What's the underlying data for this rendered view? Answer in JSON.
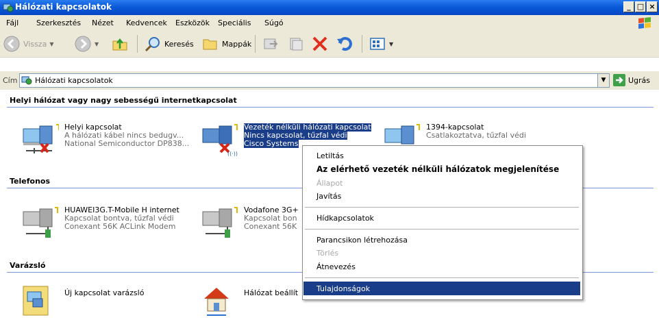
{
  "window": {
    "title": "Hálózati kapcsolatok",
    "min": "_",
    "max": "□",
    "close": "×"
  },
  "menu": [
    "Fájl",
    "Szerkesztés",
    "Nézet",
    "Kedvencek",
    "Eszközök",
    "Speciális",
    "Súgó"
  ],
  "toolbar": {
    "back": "Vissza",
    "search": "Keresés",
    "folders": "Mappák"
  },
  "address": {
    "label": "Cím",
    "value": "Hálózati kapcsolatok",
    "go": "Ugrás"
  },
  "groups": {
    "lan": "Helyi hálózat vagy nagy sebességű internetkapcsolat",
    "phone": "Telefonos",
    "wizard": "Varázsló"
  },
  "items": {
    "local": [
      "Helyi kapcsolat",
      "A hálózati kábel nincs bedugv...",
      "National Semiconductor DP838..."
    ],
    "wireless": [
      "Vezeték nélküli hálózati kapcsolat",
      "Nincs kapcsolat, tűzfal védi",
      "Cisco Systems"
    ],
    "fw1394": [
      "1394-kapcsolat",
      "Csatlakoztatva, tűzfal védi"
    ],
    "huawei": [
      "HUAWEI3G.T-Mobile H internet",
      "Kapcsolat bontva, tűzfal védi",
      "Conexant 56K ACLink Modem"
    ],
    "vodafone": [
      "Vodafone 3G+",
      "Kapcsolat bon",
      "Conexant 56K"
    ],
    "newconn": [
      "Új kapcsolat varázsló"
    ],
    "netsetup": [
      "Hálózat beállít"
    ]
  },
  "context_menu": {
    "disable": "Letiltás",
    "show_wireless": "Az elérhető vezeték nélküli hálózatok megjelenítése",
    "status": "Állapot",
    "repair": "Javítás",
    "bridge": "Hídkapcsolatok",
    "shortcut": "Parancsikon létrehozása",
    "delete": "Törlés",
    "rename": "Átnevezés",
    "properties": "Tulajdonságok"
  },
  "colors": {
    "title_bar": "#0a5ad8",
    "selection": "#1a3d8a",
    "group_line": "#7a96df",
    "face": "#ece9d8"
  }
}
